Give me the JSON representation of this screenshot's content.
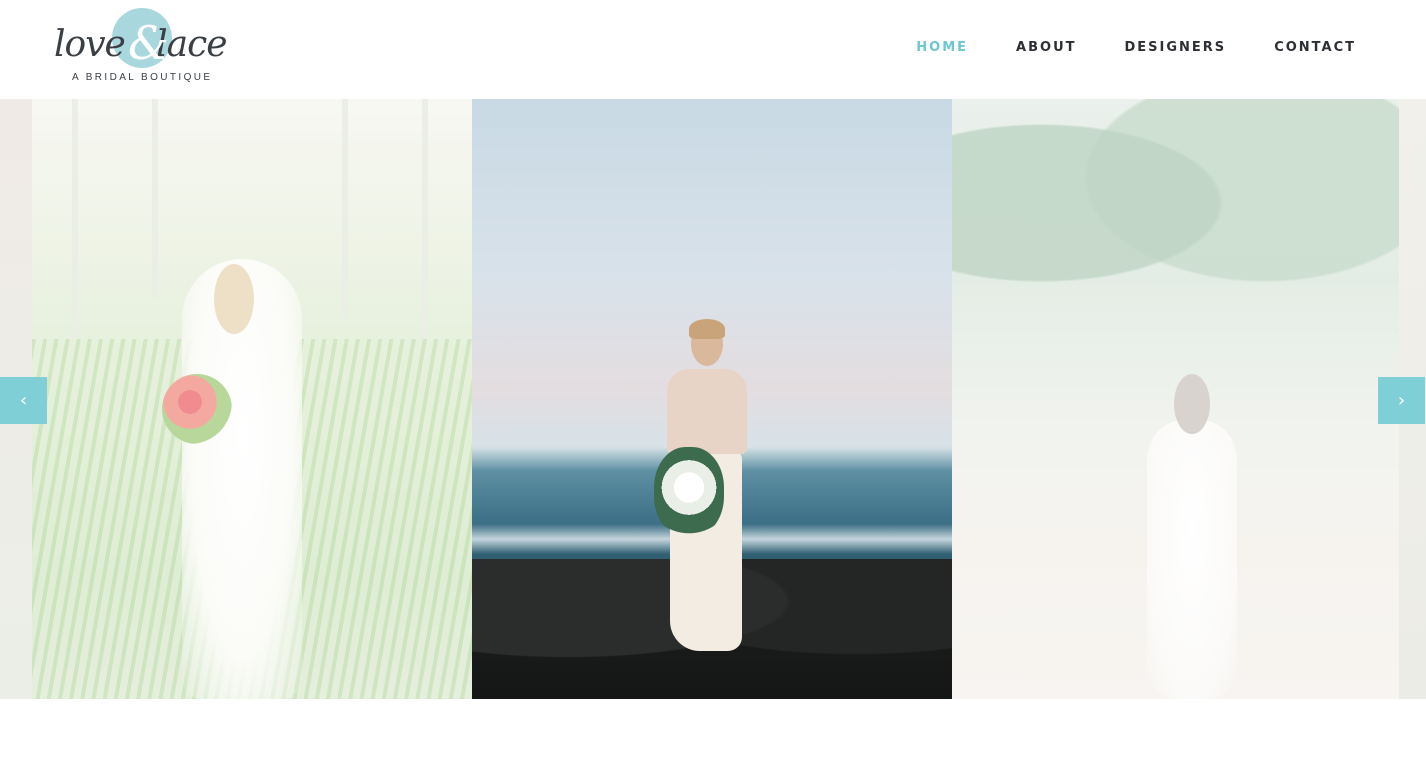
{
  "brand": {
    "logo_script": "love&lace",
    "logo_ampersand": "&",
    "tagline": "A BRIDAL BOUTIQUE",
    "accent_color": "#6cc7cf"
  },
  "nav": {
    "items": [
      {
        "label": "HOME",
        "active": true
      },
      {
        "label": "ABOUT",
        "active": false
      },
      {
        "label": "DESIGNERS",
        "active": false
      },
      {
        "label": "CONTACT",
        "active": false
      }
    ]
  },
  "slider": {
    "prev_icon": "chevron-left-icon",
    "next_icon": "chevron-right-icon",
    "prev_glyph": "‹",
    "next_glyph": "›",
    "slides": [
      {
        "name": "jungle-bride-photo",
        "active": false
      },
      {
        "name": "beach-rocks-bride-photo",
        "active": true
      },
      {
        "name": "sandy-beach-bride-photo",
        "active": false
      }
    ]
  }
}
